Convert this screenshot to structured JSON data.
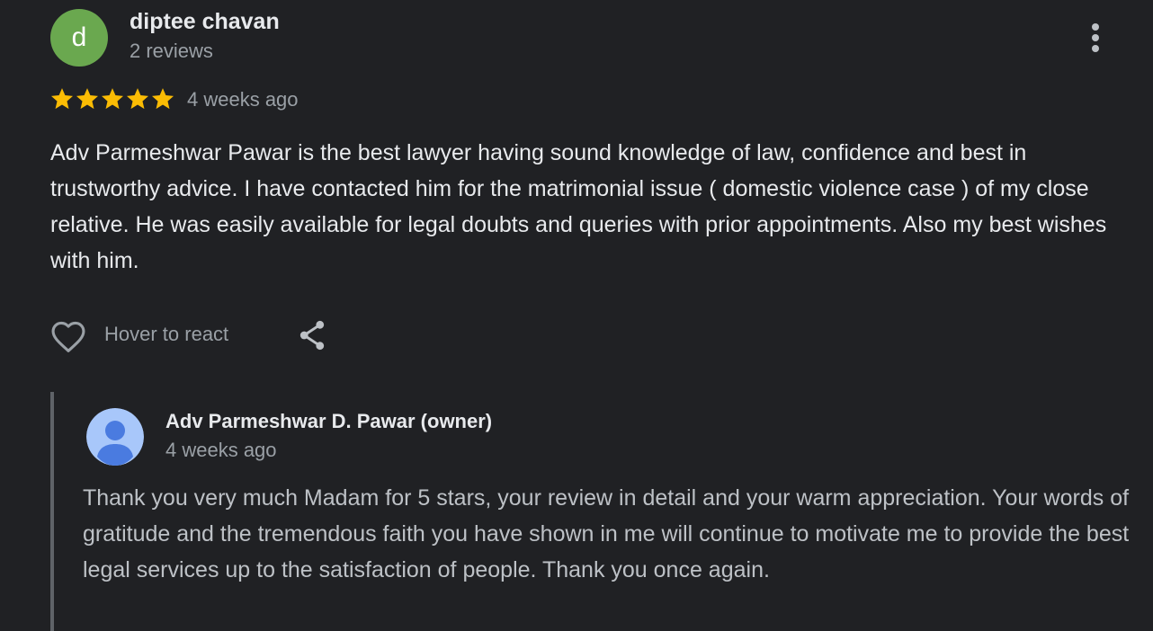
{
  "colors": {
    "background": "#202124",
    "avatar": "#6aa84f",
    "star": "#fbbc04",
    "owner_avatar_bg": "#a8c7fa",
    "owner_avatar_fg": "#4a7be0"
  },
  "review": {
    "reviewer": {
      "initial": "d",
      "name": "diptee chavan",
      "review_count": "2 reviews"
    },
    "rating": 5,
    "max_rating": 5,
    "time": "4 weeks ago",
    "text": "Adv Parmeshwar Pawar is the best lawyer having sound knowledge of law, confidence and best in trustworthy advice. I have contacted him for the matrimonial issue ( domestic violence case ) of my close relative. He was easily available for legal doubts and queries with prior appointments. Also my best wishes with him.",
    "actions": {
      "like_icon": "heart-outline-icon",
      "hover_label": "Hover to react",
      "share_icon": "share-icon",
      "more_icon": "more-vert-icon"
    },
    "owner_response": {
      "avatar_icon": "person-icon",
      "name": "Adv Parmeshwar D. Pawar (owner)",
      "time": "4 weeks ago",
      "text": "Thank you very much Madam for 5 stars, your review in detail and your warm appreciation. Your words of gratitude and the tremendous faith you have shown in me will continue to motivate me to provide the best legal services up to the satisfaction of people. Thank you once again."
    }
  }
}
